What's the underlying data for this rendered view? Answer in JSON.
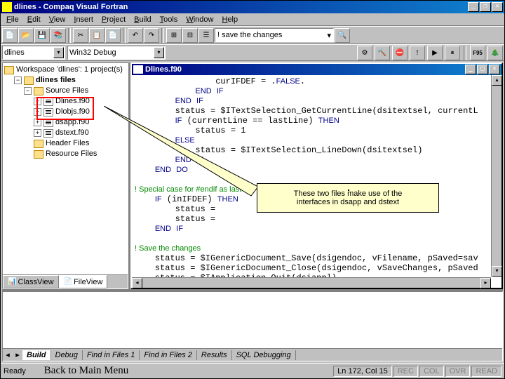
{
  "app": {
    "title": "dlines - Compaq Visual Fortran"
  },
  "menu": [
    "File",
    "Edit",
    "View",
    "Insert",
    "Project",
    "Build",
    "Tools",
    "Window",
    "Help"
  ],
  "toolbar": {
    "save_changes": "! save the changes"
  },
  "combo": {
    "target": "dlines",
    "config": "Win32 Debug"
  },
  "tree": {
    "root": "Workspace 'dlines': 1 project(s)",
    "project": "dlines files",
    "folders": {
      "source": "Source Files",
      "header": "Header Files",
      "resource": "Resource Files"
    },
    "files": [
      "Dlines.f90",
      "Dlobjs.f90",
      "dsapp.f90",
      "dstext.f90"
    ],
    "tabs": {
      "class": "ClassView",
      "file": "FileView"
    }
  },
  "code": {
    "filename": "Dlines.f90",
    "lines": [
      "                curIFDEF = .FALSE.",
      "            END IF",
      "        END IF",
      "        status = $ITextSelection_GetCurrentLine(dsitextsel, currentL",
      "        IF (currentLine == lastLine) THEN",
      "            status = 1",
      "        ELSE",
      "            status = $ITextSelection_LineDown(dsitextsel)",
      "        END IF",
      "    END DO",
      "",
      "! Special case for #endif as last line in the source file",
      "    IF (inIFDEF) THEN",
      "        status =",
      "        status =",
      "    END IF",
      "",
      "! Save the changes",
      "    status = $IGenericDocument_Save(dsigendoc, vFilename, pSaved=sav",
      "    status = $IGenericDocument_Close(dsigendoc, vSaveChanges, pSaved",
      "    status = $IApplication_Quit(dsiappl)"
    ]
  },
  "callout": {
    "line1": "These two files make use of the",
    "line2": "interfaces in dsapp and dstext"
  },
  "output_tabs": [
    "Build",
    "Debug",
    "Find in Files 1",
    "Find in Files 2",
    "Results",
    "SQL Debugging"
  ],
  "status": {
    "ready": "Ready",
    "back": "Back to Main Menu",
    "pos": "Ln 172, Col 15",
    "ind": [
      "REC",
      "COL",
      "OVR",
      "READ"
    ]
  }
}
